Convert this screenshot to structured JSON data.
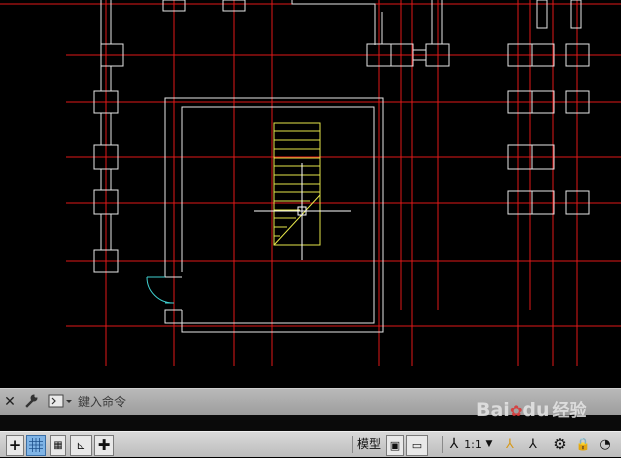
{
  "app": {
    "title": "CAD drawing viewport"
  },
  "drawing": {
    "layers": [
      {
        "name": "axis-lines",
        "color": "#e01818"
      },
      {
        "name": "walls",
        "color": "#e6e6e6"
      },
      {
        "name": "staircase",
        "color": "#e6e64a"
      },
      {
        "name": "door",
        "color": "#3fd0d0"
      }
    ]
  },
  "command_line": {
    "placeholder": "鍵入命令",
    "close_icon": "close-icon",
    "settings_icon": "wrench-icon",
    "prompt_icon": "command-prompt-icon"
  },
  "status_bar": {
    "model_tab": "模型",
    "scale": "1:1",
    "icons": [
      "crosshair-icon",
      "grid-icon",
      "snap-icon",
      "ortho-icon",
      "polar-icon",
      "layout-icon",
      "annotation-icon",
      "workspace-icon",
      "lock-icon",
      "settings-icon"
    ]
  },
  "watermark": {
    "brand": "Bai",
    "brand2": "du",
    "suffix": "经验"
  }
}
